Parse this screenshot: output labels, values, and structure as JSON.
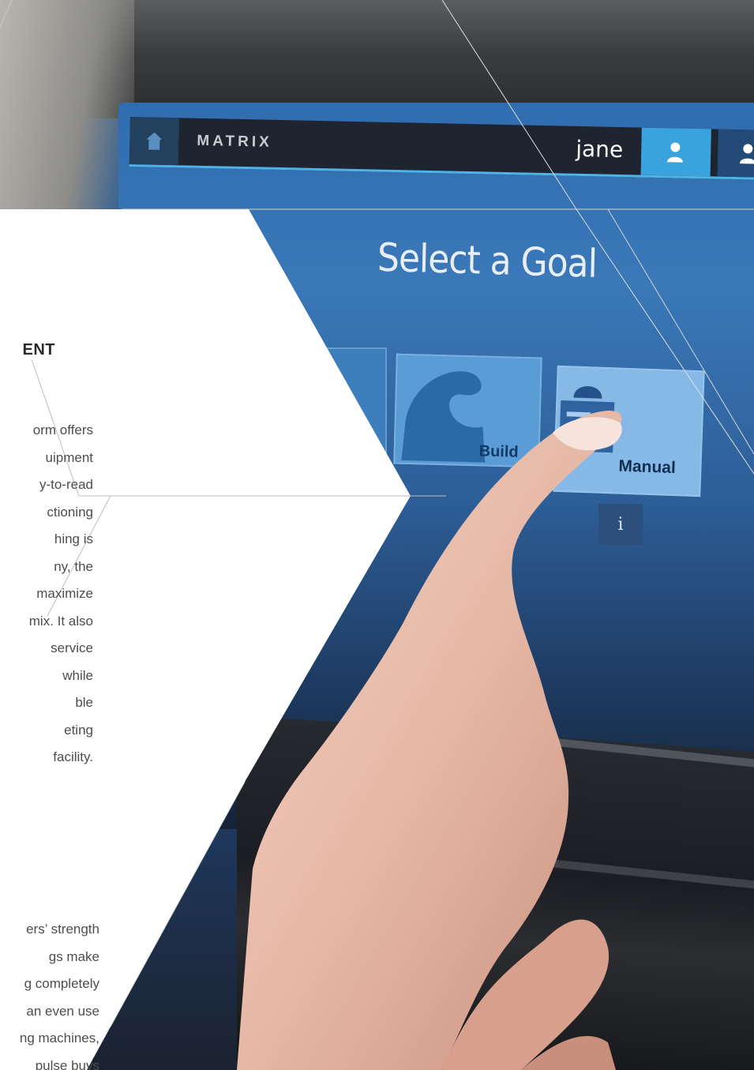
{
  "panel": {
    "heading": "ENT",
    "paragraph_1": [
      "orm offers",
      "uipment",
      "y-to-read",
      "ctioning",
      "hing is",
      "ny, the",
      "maximize",
      "mix. It also",
      " service",
      "while",
      "ble",
      "eting",
      "facility."
    ],
    "paragraph_2": [
      "ers’ strength",
      "gs make",
      "g completely",
      "an even use",
      "ng machines,",
      "pulse buys"
    ]
  },
  "console": {
    "brand": "MATRIX",
    "user_name": "jane",
    "screen_title": "Select a Goal",
    "tiles": [
      {
        "label": ""
      },
      {
        "label": "Build"
      },
      {
        "label": "Manual"
      }
    ],
    "info_label": "i"
  },
  "icons": {
    "home": "home-icon",
    "user": "user-icon",
    "muscle": "flexed-arm-icon",
    "manual": "manual-icon"
  },
  "colors": {
    "accent": "#4fb3e8",
    "user_button": "#3aa3de",
    "text_dark": "#2a2a2a",
    "text_body": "#4d4d4d"
  }
}
